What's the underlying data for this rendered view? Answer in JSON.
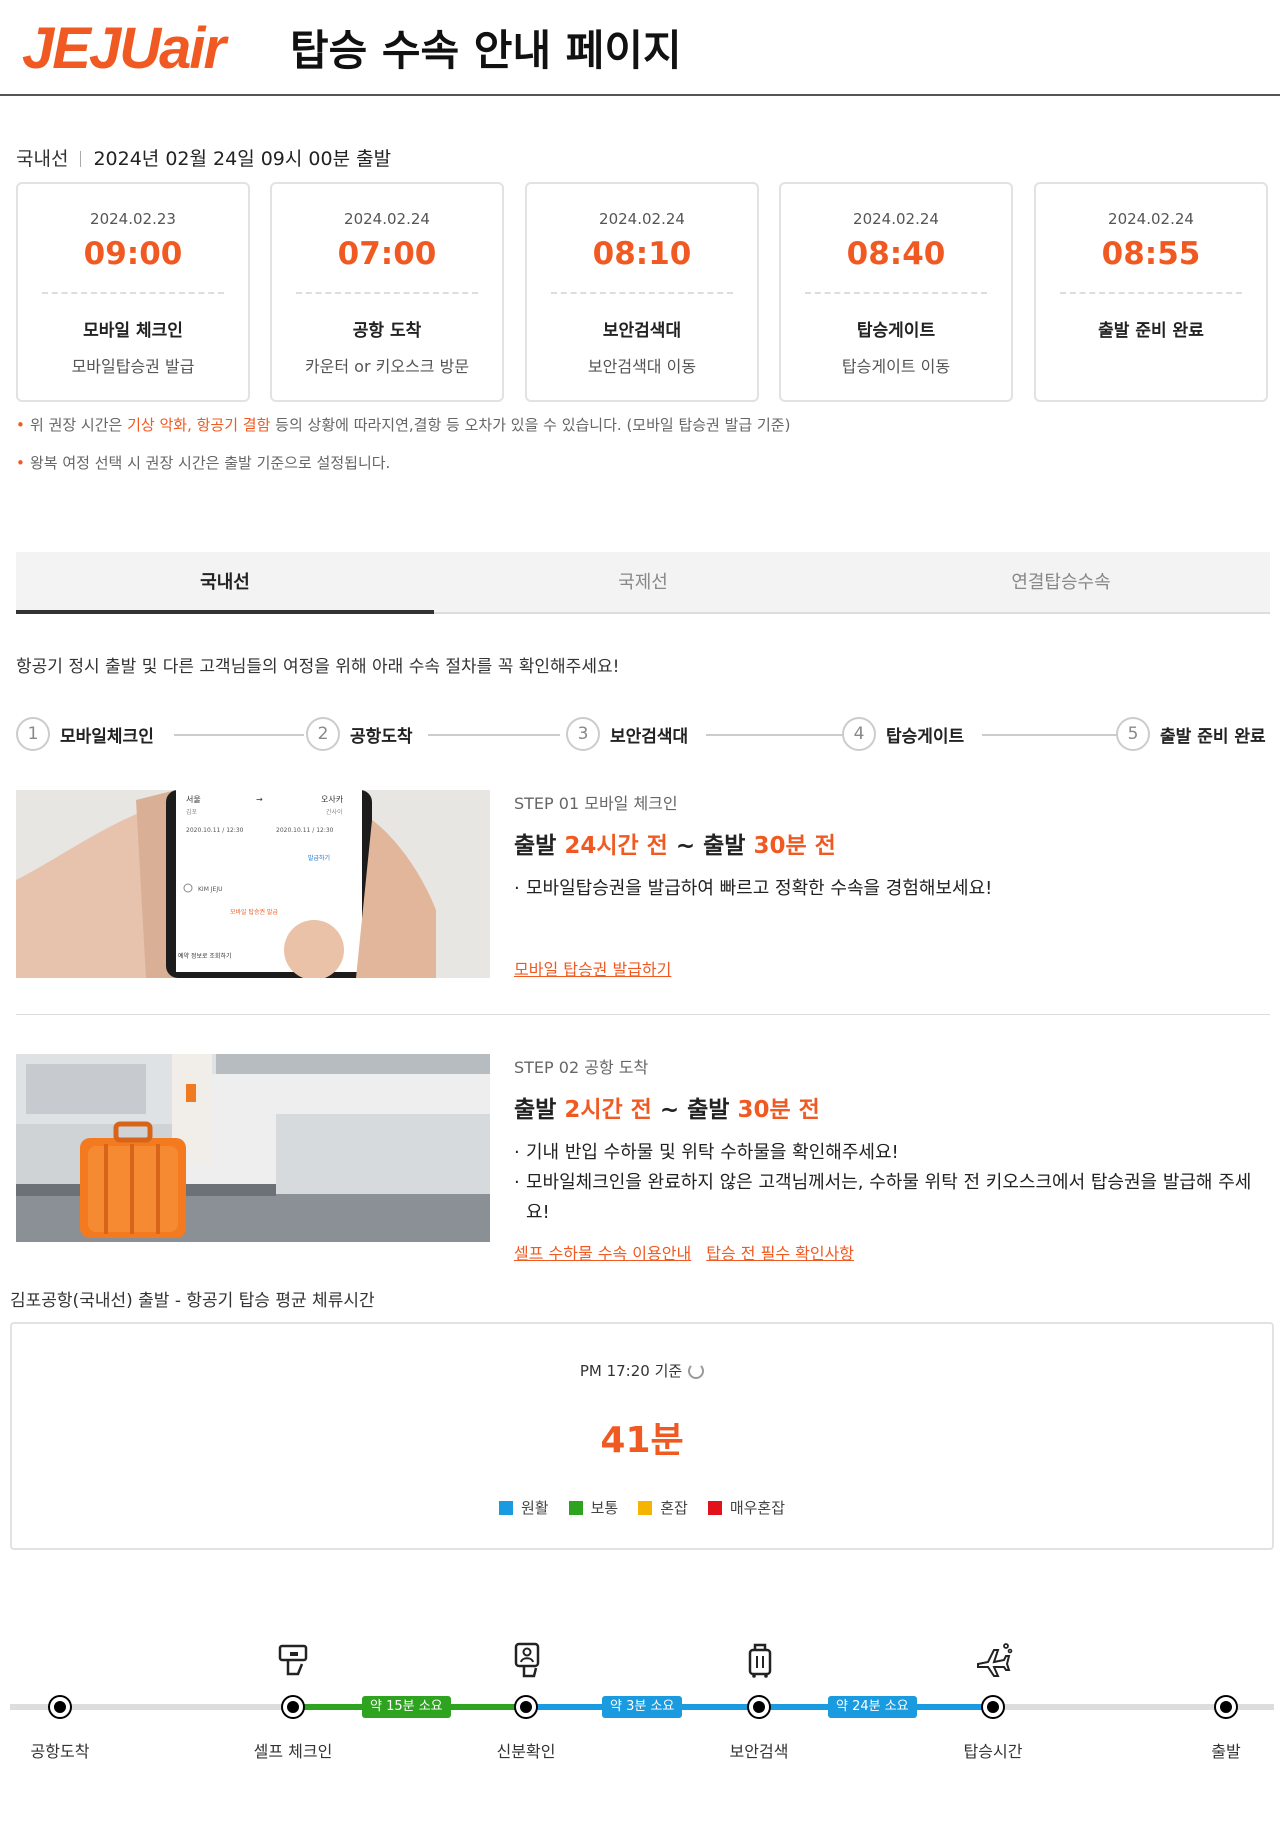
{
  "header": {
    "logo_text": "JEJUair",
    "title": "탑승 수속 안내 페이지"
  },
  "flight": {
    "type": "국내선",
    "departure": "2024년 02월 24일 09시 00분 출발"
  },
  "cards": [
    {
      "date": "2024.02.23",
      "time": "09:00",
      "title": "모바일 체크인",
      "sub": "모바일탑승권 발급"
    },
    {
      "date": "2024.02.24",
      "time": "07:00",
      "title": "공항 도착",
      "sub": "카운터 or 키오스크 방문"
    },
    {
      "date": "2024.02.24",
      "time": "08:10",
      "title": "보안검색대",
      "sub": "보안검색대 이동"
    },
    {
      "date": "2024.02.24",
      "time": "08:40",
      "title": "탑승게이트",
      "sub": "탑승게이트 이동"
    },
    {
      "date": "2024.02.24",
      "time": "08:55",
      "title": "출발 준비 완료",
      "sub": ""
    }
  ],
  "notes": {
    "n1_a": "위 권장 시간은 ",
    "n1_hl": "기상 악화, 항공기 결함",
    "n1_b": " 등의 상황에 따라지연,결항 등 오차가 있을 수 있습니다. (모바일 탑승권 발급 기준)",
    "n2": "왕복 여정 선택 시 권장 시간은 출발 기준으로 설정됩니다."
  },
  "tabs": [
    {
      "label": "국내선",
      "active": true
    },
    {
      "label": "국제선",
      "active": false
    },
    {
      "label": "연결탑승수속",
      "active": false
    }
  ],
  "intro": "항공기 정시 출발 및 다른 고객님들의 여정을 위해 아래 수속 절차를 꼭 확인해주세요!",
  "steps": [
    {
      "num": "1",
      "label": "모바일체크인"
    },
    {
      "num": "2",
      "label": "공항도착"
    },
    {
      "num": "3",
      "label": "보안검색대"
    },
    {
      "num": "4",
      "label": "탑승게이트"
    },
    {
      "num": "5",
      "label": "출발 준비 완료"
    }
  ],
  "step1": {
    "tag": "STEP 01 모바일 체크인",
    "h_a": "출발 ",
    "h_b": "24시간 전",
    "h_c": " ~ 출발 ",
    "h_d": "30분 전",
    "bullet1": "모바일탑승권을 발급하여 빠르고 정확한 수속을 경험해보세요!",
    "link1": "모바일 탑승권 발급하기",
    "phone": {
      "from": "서울",
      "arrow": "→",
      "to": "오사카",
      "from_code": "김포",
      "to_code": "간사이",
      "dt1": "2020.10.11 / 12:30",
      "dt2": "2020.10.11 / 12:30",
      "issue": "발급하기",
      "airline": "KIM JEJU",
      "btn": "모바일 탑승권 발급",
      "footer": "예약 정보로 조회하기"
    }
  },
  "step2": {
    "tag": "STEP 02 공항 도착",
    "h_a": "출발 ",
    "h_b": "2시간 전",
    "h_c": " ~ 출발 ",
    "h_d": "30분 전",
    "bullet1": "기내 반입 수하물 및 위탁 수하물을 확인해주세요!",
    "bullet2": "모바일체크인을 완료하지 않은 고객님께서는, 수하물 위탁 전 키오스크에서 탑승권을 발급해 주세요!",
    "link1": "셀프 수하물 수속 이용안내",
    "link2": "탑승 전 필수 확인사항"
  },
  "wait": {
    "title": "김포공항(국내선) 출발 - 항공기 탑승 평균 체류시간",
    "standard": "PM 17:20 기준",
    "value": "41분",
    "legend": [
      {
        "label": "원활",
        "color": "#1a9be0"
      },
      {
        "label": "보통",
        "color": "#2ea31f"
      },
      {
        "label": "혼잡",
        "color": "#f4b400"
      },
      {
        "label": "매우혼잡",
        "color": "#e0131a"
      }
    ]
  },
  "timeline": {
    "nodes": [
      "공항도착",
      "셀프 체크인",
      "신분확인",
      "보안검색",
      "탑승시간",
      "출발"
    ],
    "segments": [
      {
        "label": "약 15분 소요",
        "color": "#2ea31f"
      },
      {
        "label": "약 3분 소요",
        "color": "#1a9be0"
      },
      {
        "label": "약 24분 소요",
        "color": "#1a9be0"
      }
    ],
    "icons": [
      "kiosk-icon",
      "id-card-icon",
      "luggage-icon",
      "airplane-icon"
    ]
  }
}
